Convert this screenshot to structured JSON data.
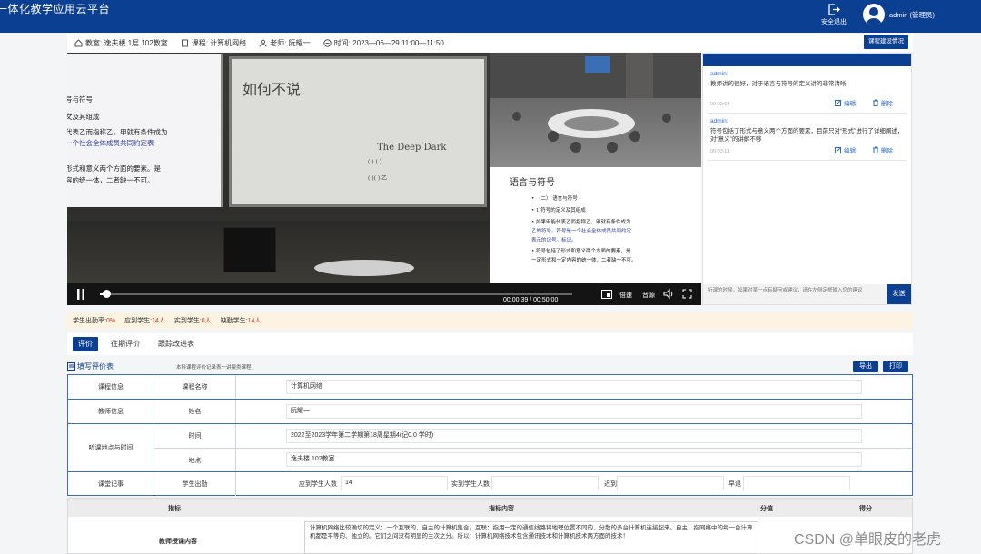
{
  "app": {
    "title": "一体化教学应用云平台"
  },
  "topbar": {
    "logout_label": "安全退出",
    "user_label": "admin (管理员)"
  },
  "info": {
    "classroom_label": "教室:",
    "classroom": "逸夫楼 1层 102教室",
    "course_label": "课程:",
    "course": "计算机网络",
    "teacher_label": "老师:",
    "teacher": "阮耀一",
    "time_label": "时间:",
    "time": "2023—06—29 11:00—11:50",
    "suggest_button": "课程建设情况"
  },
  "video": {
    "slide_left_lines": [
      "号与符号",
      "文及其组成",
      "代表乙而指称乙，甲就有条件成为",
      "一个社会全体成员共同约定表",
      "形式和意义两个方面的要素。是",
      "容的统一体，二者缺一不可。"
    ],
    "whiteboard_lines": [
      "如何不说",
      "The Deep Dark",
      "(  )  (  )",
      "(  )(  ) 乙"
    ],
    "slide_title": "语言与符号",
    "slide_lines": [
      "•   （二） 语言与符号",
      "•   1.符号的定义及其组成",
      "•   如果甲能代表乙而指称乙，甲就有条件成为",
      "乙的符号。符号是一个社会全体成员共同约定",
      "表示的记号。标记。",
      "•   符号包括了形式和意义两个方面的要素，是",
      "一定形式和一定内容的统一体，二者缺一不可。"
    ],
    "time_display": "00:00:39 / 00:50:00",
    "progress": 0.013,
    "speed_label": "倍速",
    "audio_label": "音源"
  },
  "comments": {
    "items": [
      {
        "author": "admin:",
        "text": "教师讲的很好，对于语言与符号的定义讲的非常清晰",
        "time": "00:02:04",
        "edit": "编辑",
        "delete": "删除"
      },
      {
        "author": "admin:",
        "text": "符号包括了形式与意义两个方面的要素，目前只对“形式”进行了详细阐述，对“意义”的讲解不够",
        "time": "00:03:13",
        "edit": "编辑",
        "delete": "删除"
      }
    ],
    "input_placeholder": "听课的时候，如果对某一点有疑问或建议，请在左侧定框输入您的建议",
    "send_label": "发送"
  },
  "attendance": [
    {
      "label": "学生出勤率:",
      "value": "0%"
    },
    {
      "label": "应到学生:",
      "value": "14人"
    },
    {
      "label": "实到学生:",
      "value": "0人"
    },
    {
      "label": "缺勤学生:",
      "value": "14人"
    }
  ],
  "tabs": [
    {
      "label": "评价"
    },
    {
      "label": "往期评价"
    },
    {
      "label": "跟踪改进表"
    }
  ],
  "form": {
    "title": "填写评价表",
    "subtitle": "本科课程评价记录表一讲授类课程",
    "export_button": "导出",
    "print_button": "打印"
  },
  "table": {
    "course_info": "课程信息",
    "course_name_label": "课程名称",
    "course_name": "计算机网络",
    "teacher_info": "教师信息",
    "name_label": "姓名",
    "name": "阮耀一",
    "place_time": "听课地点与时间",
    "time_label": "时间",
    "time_value": "2022至2023学年第二学期第18周星期4(记0.0 学时)",
    "place_label": "地点",
    "place_value": "逸夫楼 102教室",
    "classroom_notes": "课堂记事",
    "attendance_label": "学生出勤",
    "expected_label": "应到学生人数",
    "expected_value": "14",
    "actual_label": "实到学生人数",
    "late_label": "迟到",
    "early_label": "早退"
  },
  "rubric": {
    "col_indicator": "指标",
    "col_content": "指标内容",
    "col_score": "分值",
    "col_grade": "得分",
    "indicator": "教师授课内容",
    "content": "计算机网络比较确切的定义：一个互联的、自主的计算机集合。互联：指用一定的通信线路将地理位置不同的、分散的多台计算机连接起来。自主：指网络中的每一台计算机都是平等的、独立的。它们之间没有明显的主次之分。所以：计算机网络技术包含通讯技术和计算机技术两方面的技术！"
  },
  "watermark": "CSDN @单眼皮的老虎"
}
